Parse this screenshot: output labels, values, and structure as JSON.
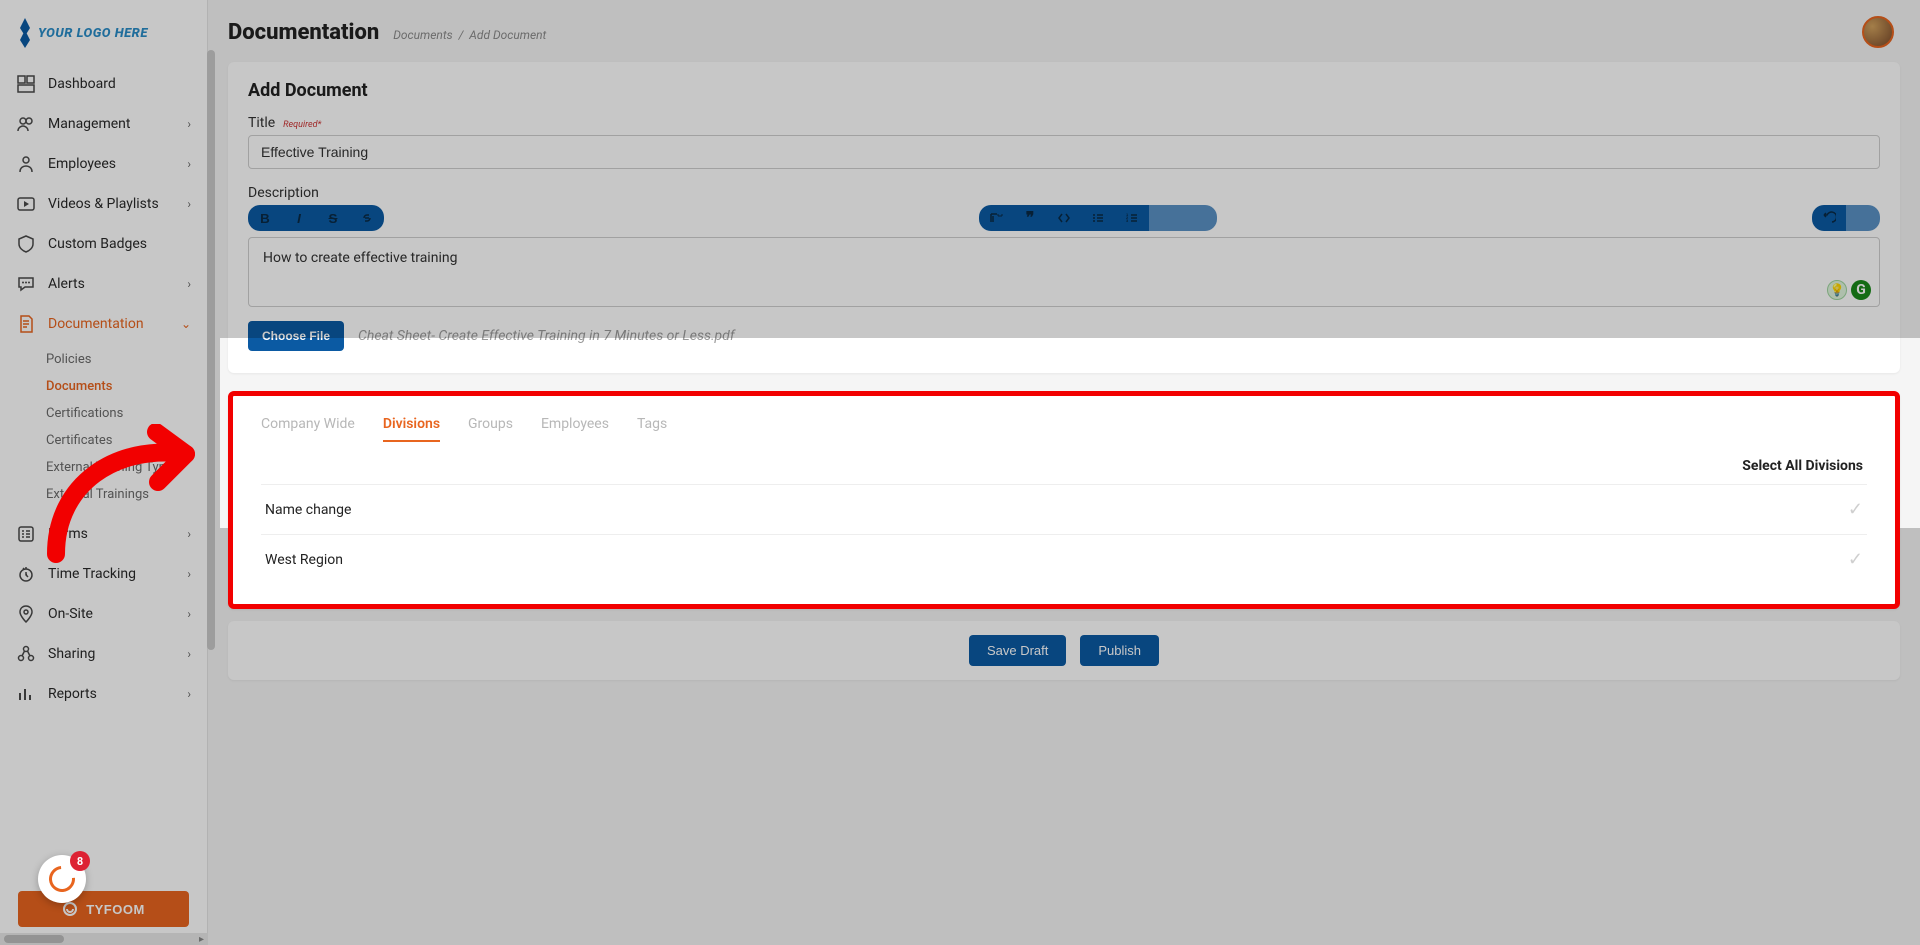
{
  "branding": {
    "logo_text": "YOUR LOGO HERE"
  },
  "header": {
    "title": "Documentation",
    "breadcrumb_parent": "Documents",
    "breadcrumb_sep": "/",
    "breadcrumb_current": "Add Document"
  },
  "sidebar": {
    "items": [
      {
        "label": "Dashboard",
        "icon": "dashboard-icon",
        "chevron": false
      },
      {
        "label": "Management",
        "icon": "users-icon",
        "chevron": true
      },
      {
        "label": "Employees",
        "icon": "person-icon",
        "chevron": true
      },
      {
        "label": "Videos & Playlists",
        "icon": "play-icon",
        "chevron": true
      },
      {
        "label": "Custom Badges",
        "icon": "shield-icon",
        "chevron": false
      },
      {
        "label": "Alerts",
        "icon": "chat-icon",
        "chevron": true
      },
      {
        "label": "Documentation",
        "icon": "document-icon",
        "chevron": true,
        "expanded": true,
        "active": true,
        "children": [
          {
            "label": "Policies"
          },
          {
            "label": "Documents",
            "active": true
          },
          {
            "label": "Certifications"
          },
          {
            "label": "Certificates"
          },
          {
            "label": "External Training Types"
          },
          {
            "label": "External Trainings"
          }
        ]
      },
      {
        "label": "Forms",
        "icon": "form-icon",
        "chevron": true
      },
      {
        "label": "Time Tracking",
        "icon": "clock-icon",
        "chevron": true
      },
      {
        "label": "On-Site",
        "icon": "pin-icon",
        "chevron": true
      },
      {
        "label": "Sharing",
        "icon": "share-icon",
        "chevron": true
      },
      {
        "label": "Reports",
        "icon": "chart-icon",
        "chevron": true
      }
    ],
    "footer_button": "TYFOOM"
  },
  "chat": {
    "badge": "8"
  },
  "form": {
    "card_title": "Add Document",
    "title_label": "Title",
    "title_required": "Required*",
    "title_value": "Effective Training",
    "description_label": "Description",
    "description_value": "How to create effective training",
    "choose_file_label": "Choose File",
    "file_name": "Cheat Sheet- Create Effective Training in 7 Minutes or Less.pdf"
  },
  "tabs": {
    "items": [
      {
        "label": "Company Wide"
      },
      {
        "label": "Divisions",
        "active": true
      },
      {
        "label": "Groups"
      },
      {
        "label": "Employees"
      },
      {
        "label": "Tags"
      }
    ],
    "select_all_label": "Select All Divisions",
    "divisions": [
      {
        "name": "Name change"
      },
      {
        "name": "West Region"
      }
    ]
  },
  "actions": {
    "save_draft": "Save Draft",
    "publish": "Publish"
  }
}
